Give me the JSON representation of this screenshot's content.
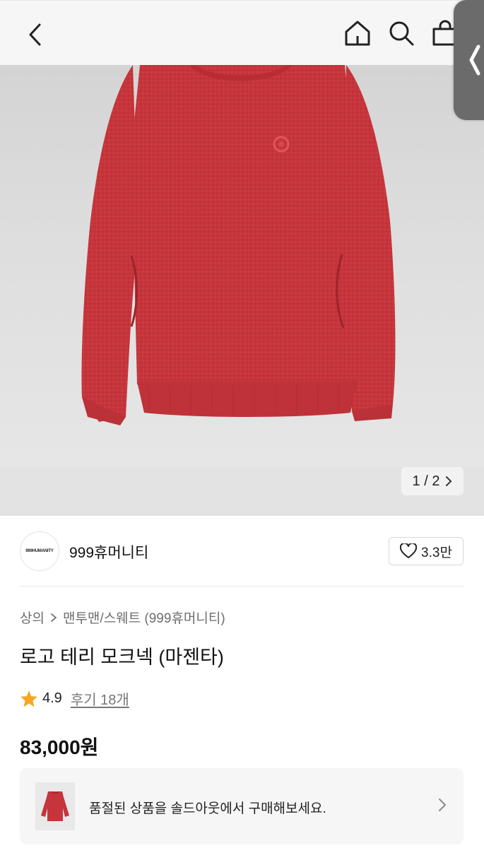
{
  "nav": {
    "back_icon": "chevron-left-icon",
    "home_icon": "home-icon",
    "search_icon": "search-icon",
    "bag_icon": "shopping-bag-icon",
    "side_handle_icon": "chevron-left-icon"
  },
  "gallery": {
    "current": 1,
    "total": 2,
    "counter_text": "1 / 2",
    "product_color": "#c5353b"
  },
  "brand": {
    "logo_text": "999HUMANITY",
    "name": "999휴머니티",
    "likes": "3.3만"
  },
  "breadcrumb": {
    "category": "상의",
    "subcategory": "맨투맨/스웨트 (999휴머니티)"
  },
  "product": {
    "title": "로고 테리 모크넥 (마젠타)",
    "rating": "4.9",
    "reviews": "후기 18개",
    "price": "83,000원"
  },
  "soldout_banner": {
    "text": "품절된 상품을 솔드아웃에서 구매해보세요."
  },
  "colors": {
    "star": "#f5a623",
    "product_red": "#c5353b",
    "handle": "#6b6b6b"
  }
}
